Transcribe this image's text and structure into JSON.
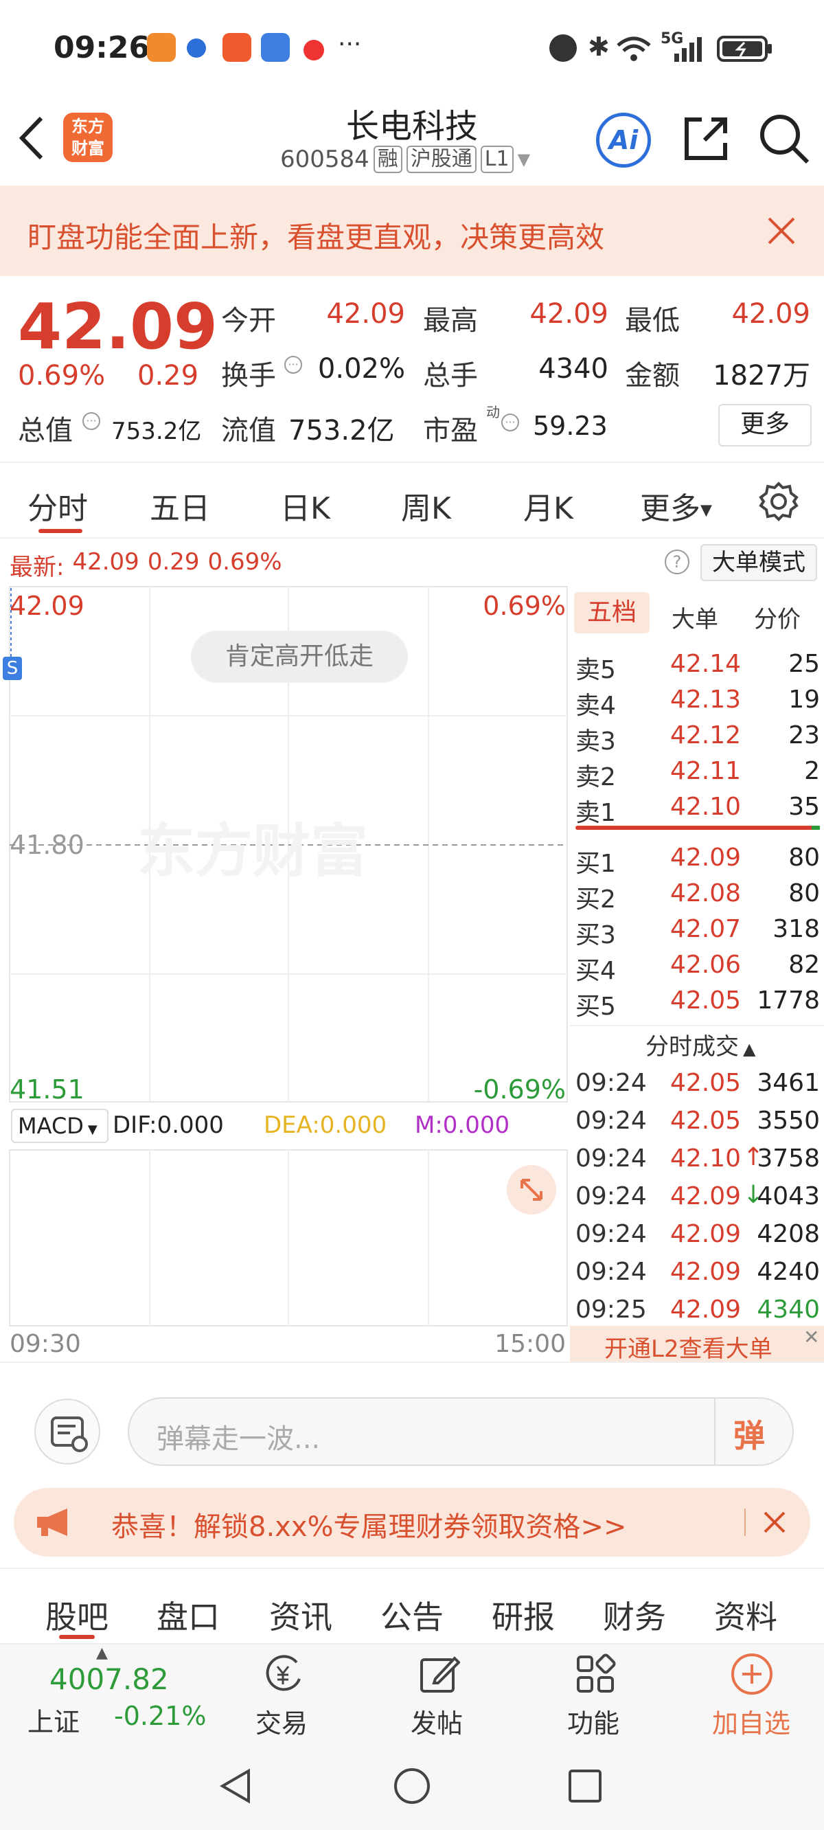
{
  "status_bar": {
    "time": "09:26",
    "more": "···",
    "network": "5G"
  },
  "header": {
    "title": "长电科技",
    "code": "600584",
    "tag_rong": "融",
    "tag_hgt": "沪股通",
    "tag_level": "L1",
    "logo_line1": "东方",
    "logo_line2": "财富",
    "ai_label": "Ai"
  },
  "notice": {
    "text": "盯盘功能全面上新，看盘更直观，决策更高效"
  },
  "quote": {
    "price": "42.09",
    "change_pct": "0.69%",
    "change": "0.29",
    "open_label": "今开",
    "open": "42.09",
    "high_label": "最高",
    "high": "42.09",
    "low_label": "最低",
    "low": "42.09",
    "turnover_label": "换手",
    "turnover": "0.02%",
    "volume_label": "总手",
    "volume": "4340",
    "amount_label": "金额",
    "amount": "1827万",
    "mktcap_label": "总值",
    "mktcap": "753.2亿",
    "float_label": "流值",
    "float": "753.2亿",
    "pe_label": "市盈",
    "pe_sup": "动",
    "pe": "59.23",
    "more_button": "更多"
  },
  "tabs": [
    "分时",
    "五日",
    "日K",
    "周K",
    "月K",
    "更多"
  ],
  "latest": {
    "label": "最新:",
    "price": "42.09",
    "change": "0.29",
    "pct": "0.69%",
    "big_order_mode": "大单模式",
    "help": "?"
  },
  "chart": {
    "top_price": "42.09",
    "top_pct": "0.69%",
    "mid_price": "41.80",
    "bottom_price": "41.51",
    "bottom_pct": "-0.69%",
    "tip": "肯定高开低走",
    "watermark": "东方财富",
    "s_marker": "S",
    "macd_label": "MACD",
    "dif": "DIF:0.000",
    "dea": "DEA:0.000",
    "m": "M:0.000",
    "time_start": "09:30",
    "time_end": "15:00"
  },
  "book": {
    "tabs": [
      "五档",
      "大单",
      "分价"
    ],
    "asks": [
      {
        "label": "卖5",
        "price": "42.14",
        "vol": "25"
      },
      {
        "label": "卖4",
        "price": "42.13",
        "vol": "19"
      },
      {
        "label": "卖3",
        "price": "42.12",
        "vol": "23"
      },
      {
        "label": "卖2",
        "price": "42.11",
        "vol": "2"
      },
      {
        "label": "卖1",
        "price": "42.10",
        "vol": "35"
      }
    ],
    "bids": [
      {
        "label": "买1",
        "price": "42.09",
        "vol": "80"
      },
      {
        "label": "买2",
        "price": "42.08",
        "vol": "80"
      },
      {
        "label": "买3",
        "price": "42.07",
        "vol": "318"
      },
      {
        "label": "买4",
        "price": "42.06",
        "vol": "82"
      },
      {
        "label": "买5",
        "price": "42.05",
        "vol": "1778"
      }
    ],
    "ticks_title": "分时成交",
    "ticks": [
      {
        "time": "09:24",
        "price": "42.05",
        "arrow": "",
        "vol": "3461",
        "vol_color": "#222"
      },
      {
        "time": "09:24",
        "price": "42.05",
        "arrow": "",
        "vol": "3550",
        "vol_color": "#222"
      },
      {
        "time": "09:24",
        "price": "42.10",
        "arrow": "↑",
        "vol": "3758",
        "vol_color": "#222"
      },
      {
        "time": "09:24",
        "price": "42.09",
        "arrow": "↓",
        "vol": "4043",
        "vol_color": "#222"
      },
      {
        "time": "09:24",
        "price": "42.09",
        "arrow": "",
        "vol": "4208",
        "vol_color": "#222"
      },
      {
        "time": "09:24",
        "price": "42.09",
        "arrow": "",
        "vol": "4240",
        "vol_color": "#222"
      },
      {
        "time": "09:25",
        "price": "42.09",
        "arrow": "",
        "vol": "4340",
        "vol_color": "#2e9b3a"
      }
    ],
    "l2_banner": "开通L2查看大单"
  },
  "danmu": {
    "placeholder": "弹幕走一波...",
    "send": "弹"
  },
  "promo": {
    "text": "恭喜！解锁8.xx%专属理财券领取资格>>"
  },
  "footer_tabs": [
    "股吧",
    "盘口",
    "资讯",
    "公告",
    "研报",
    "财务",
    "资料"
  ],
  "bottom": {
    "index_value": "4007.82",
    "index_name": "上证",
    "index_pct": "-0.21%",
    "trade": "交易",
    "post": "发帖",
    "features": "功能",
    "add_watch": "加自选"
  },
  "colors": {
    "up": "#d63d2c",
    "down": "#2e9b3a",
    "brand": "#f06a35",
    "accent": "#2d6fd8"
  }
}
